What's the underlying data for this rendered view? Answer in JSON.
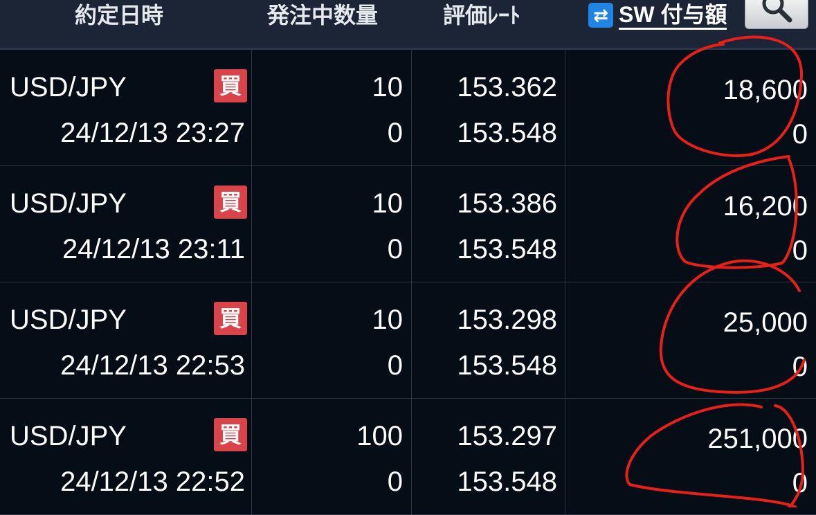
{
  "header": {
    "col_date": "約定日時",
    "col_pending_qty": "発注中数量",
    "col_rate": "評価ﾚｰﾄ",
    "col_swap": "SW 付与額",
    "swap_toggle_icon": "⇄",
    "search_icon": "search-icon"
  },
  "rows": [
    {
      "pair": "USD/JPY",
      "side": "買",
      "datetime": "24/12/13 23:27",
      "qty": "10",
      "pending_qty": "0",
      "rate": "153.362",
      "eval_rate": "153.548",
      "swap": "18,600",
      "swap_sub": "0"
    },
    {
      "pair": "USD/JPY",
      "side": "買",
      "datetime": "24/12/13 23:11",
      "qty": "10",
      "pending_qty": "0",
      "rate": "153.386",
      "eval_rate": "153.548",
      "swap": "16,200",
      "swap_sub": "0"
    },
    {
      "pair": "USD/JPY",
      "side": "買",
      "datetime": "24/12/13 22:53",
      "qty": "10",
      "pending_qty": "0",
      "rate": "153.298",
      "eval_rate": "153.548",
      "swap": "25,000",
      "swap_sub": "0"
    },
    {
      "pair": "USD/JPY",
      "side": "買",
      "datetime": "24/12/13 22:52",
      "qty": "100",
      "pending_qty": "0",
      "rate": "153.297",
      "eval_rate": "153.548",
      "swap": "251,000",
      "swap_sub": "0"
    }
  ],
  "colors": {
    "background": "#050d16",
    "header_bg": "#1b2536",
    "buy_badge": "#d9434a",
    "accent_blue": "#1f84e4",
    "annotation_red": "#e8201a"
  }
}
